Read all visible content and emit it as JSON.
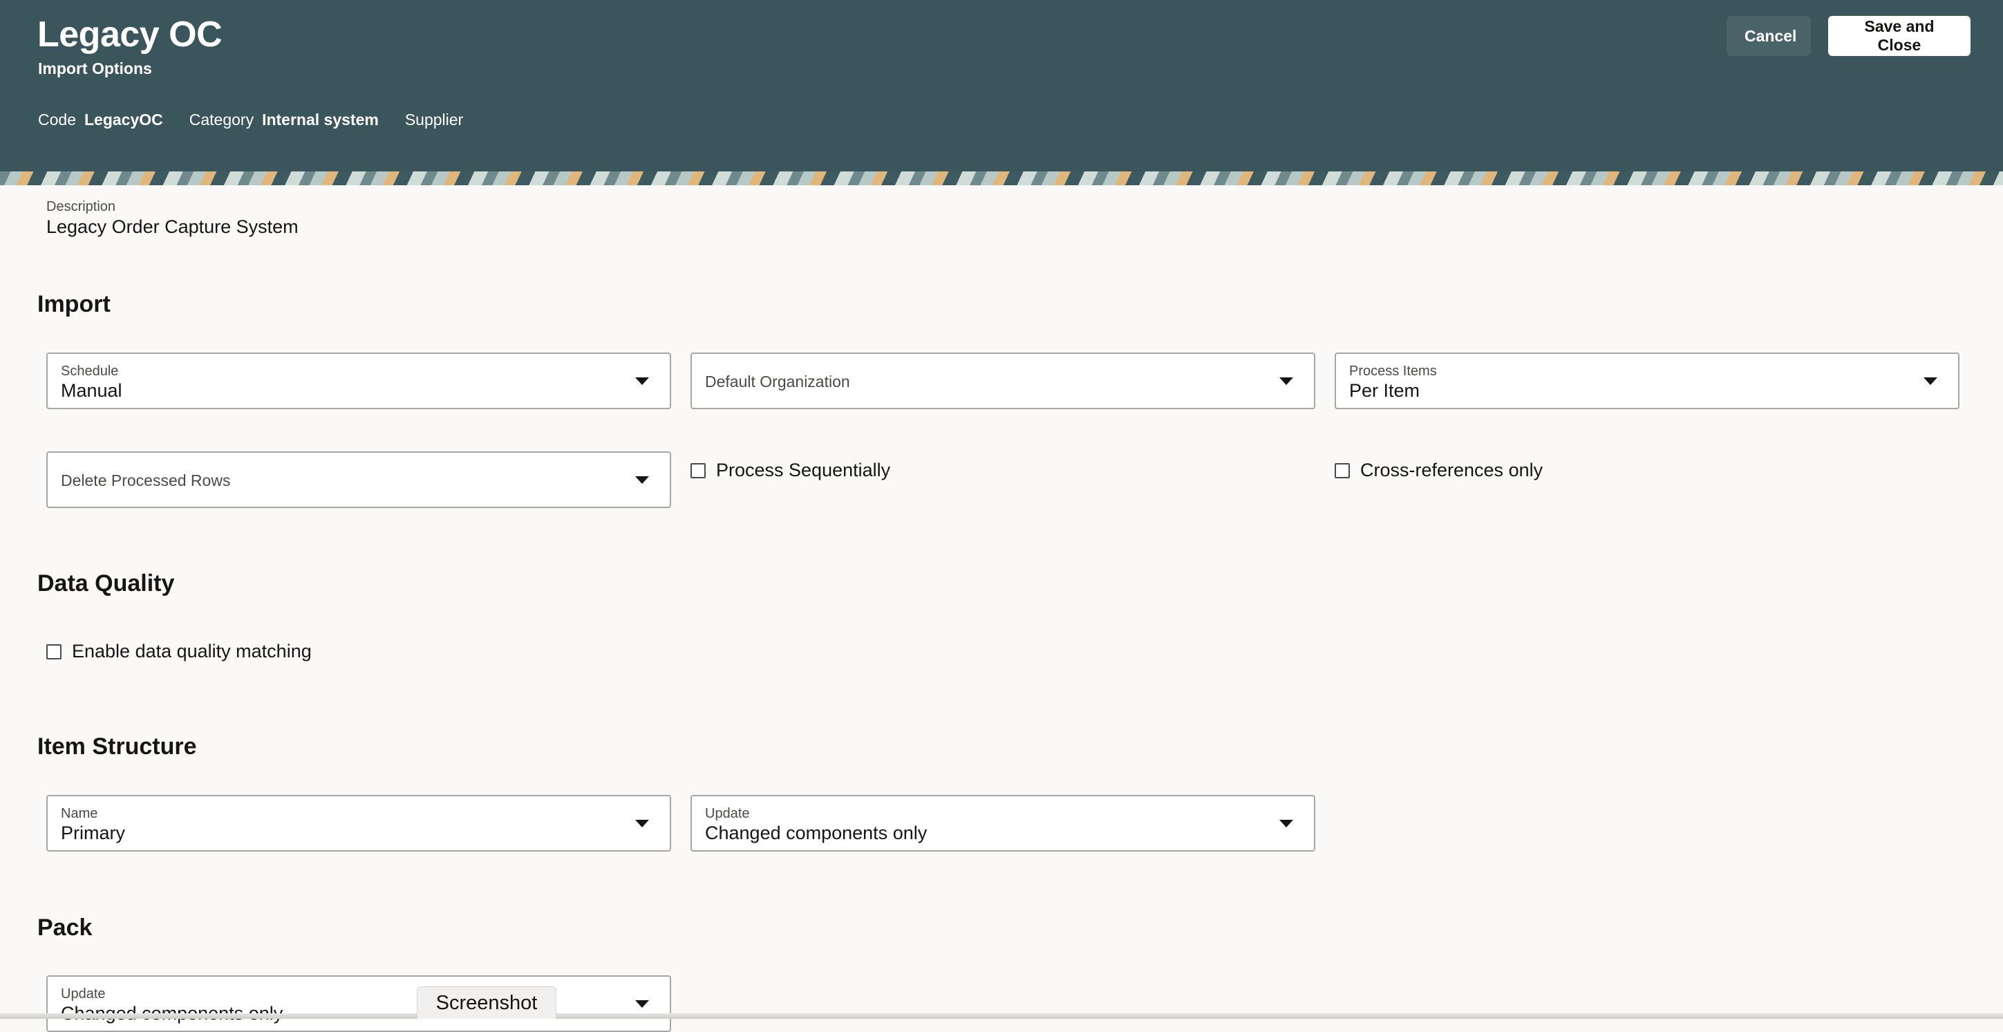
{
  "header": {
    "title": "Legacy OC",
    "subtitle": "Import Options",
    "code_label": "Code",
    "code_value": "LegacyOC",
    "category_label": "Category",
    "category_value": "Internal system",
    "type_value": "Supplier",
    "cancel_label": "Cancel",
    "save_label": "Save and Close"
  },
  "description": {
    "label": "Description",
    "value": "Legacy Order Capture System"
  },
  "import": {
    "title": "Import",
    "schedule": {
      "label": "Schedule",
      "value": "Manual"
    },
    "default_org": {
      "placeholder": "Default Organization"
    },
    "process_items": {
      "label": "Process Items",
      "value": "Per Item"
    },
    "delete_rows": {
      "placeholder": "Delete Processed Rows"
    },
    "process_sequentially": "Process Sequentially",
    "cross_references_only": "Cross-references only"
  },
  "data_quality": {
    "title": "Data Quality",
    "enable_matching": "Enable data quality matching"
  },
  "item_structure": {
    "title": "Item Structure",
    "name": {
      "label": "Name",
      "value": "Primary"
    },
    "update": {
      "label": "Update",
      "value": "Changed components only"
    }
  },
  "pack": {
    "title": "Pack",
    "update": {
      "label": "Update",
      "value": "Changed components only"
    }
  },
  "overlay": {
    "screenshot_tab": "Screenshot"
  },
  "colors": {
    "header_bg": "#3b555c",
    "page_bg": "#faf9f8",
    "cancel_bg": "#4a6369"
  }
}
